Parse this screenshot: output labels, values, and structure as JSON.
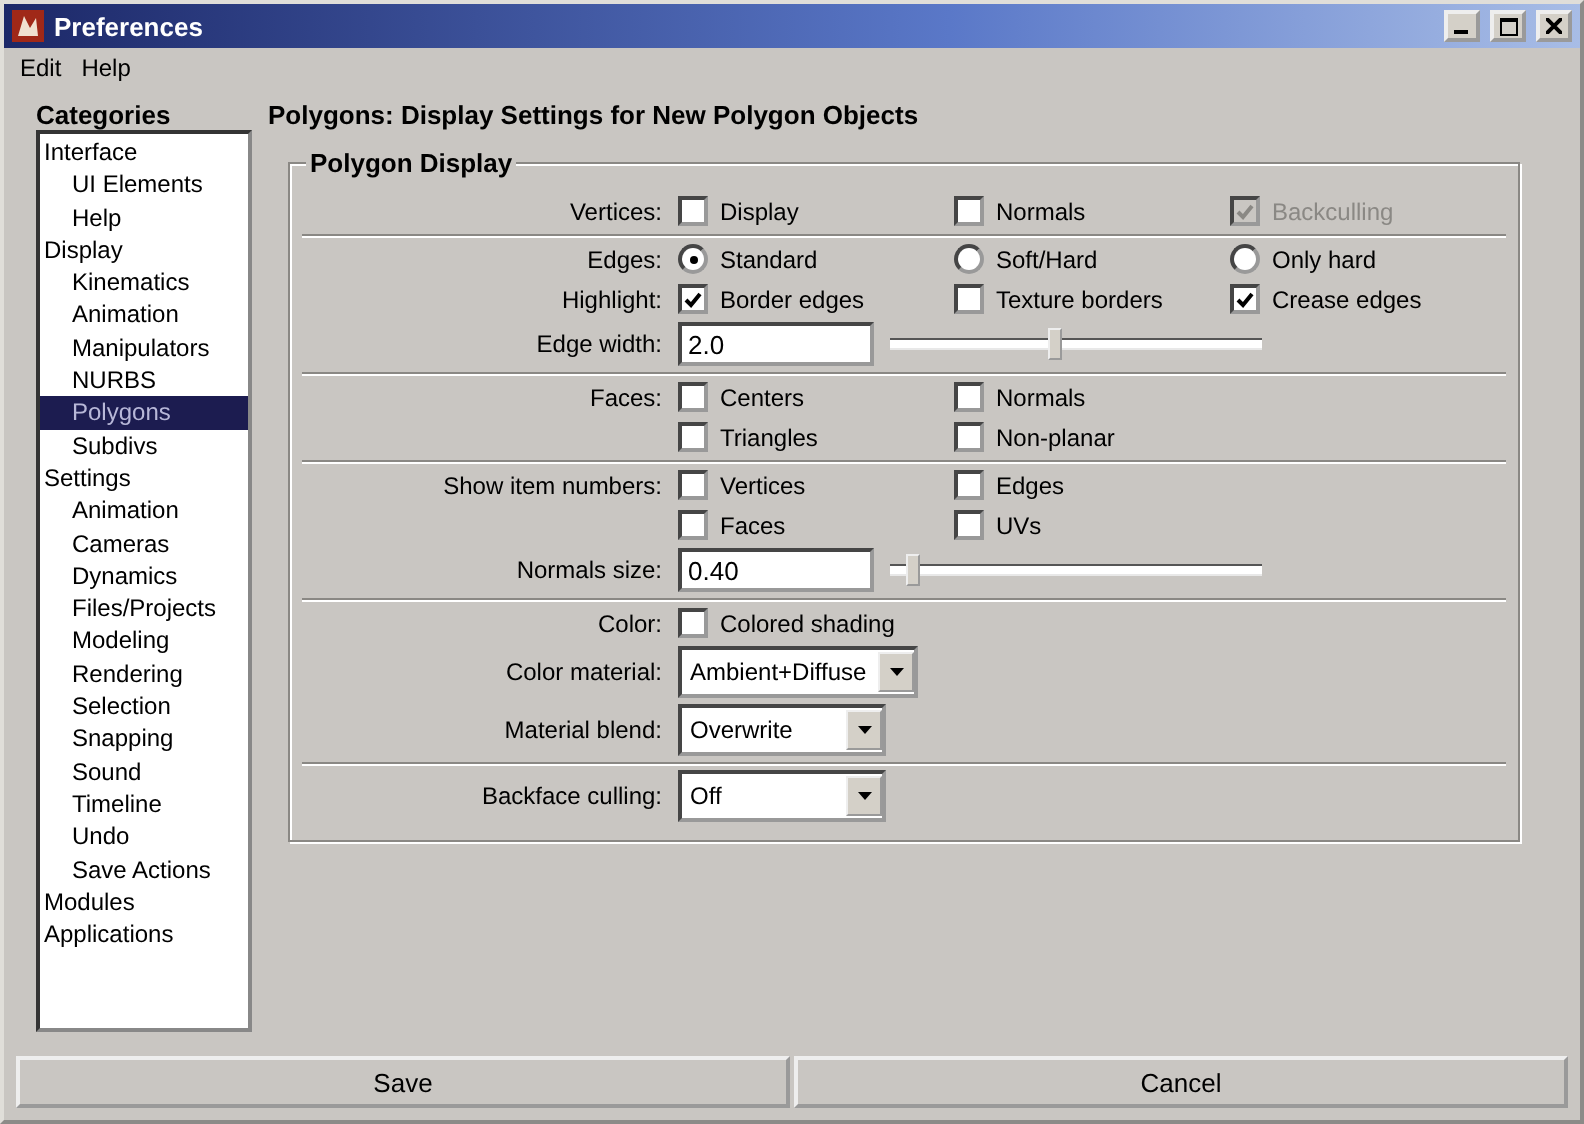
{
  "window": {
    "title": "Preferences"
  },
  "menu": [
    "Edit",
    "Help"
  ],
  "categories": {
    "title": "Categories",
    "items": [
      {
        "label": "Interface",
        "selected": false,
        "children": [
          {
            "label": "UI Elements",
            "selected": false
          },
          {
            "label": "Help",
            "selected": false
          }
        ]
      },
      {
        "label": "Display",
        "selected": false,
        "children": [
          {
            "label": "Kinematics",
            "selected": false
          },
          {
            "label": "Animation",
            "selected": false
          },
          {
            "label": "Manipulators",
            "selected": false
          },
          {
            "label": "NURBS",
            "selected": false
          },
          {
            "label": "Polygons",
            "selected": true
          },
          {
            "label": "Subdivs",
            "selected": false
          }
        ]
      },
      {
        "label": "Settings",
        "selected": false,
        "children": [
          {
            "label": "Animation",
            "selected": false
          },
          {
            "label": "Cameras",
            "selected": false
          },
          {
            "label": "Dynamics",
            "selected": false
          },
          {
            "label": "Files/Projects",
            "selected": false
          },
          {
            "label": "Modeling",
            "selected": false
          },
          {
            "label": "Rendering",
            "selected": false
          },
          {
            "label": "Selection",
            "selected": false
          },
          {
            "label": "Snapping",
            "selected": false
          },
          {
            "label": "Sound",
            "selected": false
          },
          {
            "label": "Timeline",
            "selected": false
          },
          {
            "label": "Undo",
            "selected": false
          },
          {
            "label": "Save Actions",
            "selected": false
          }
        ]
      },
      {
        "label": "Modules",
        "selected": false
      },
      {
        "label": "Applications",
        "selected": false
      }
    ]
  },
  "heading": "Polygons: Display Settings for New Polygon Objects",
  "group": {
    "title": "Polygon Display",
    "sections": [
      {
        "rows": [
          {
            "label": "Vertices:",
            "items": [
              {
                "kind": "checkbox",
                "label": "Display",
                "checked": false,
                "disabled": false
              },
              {
                "kind": "checkbox",
                "label": "Normals",
                "checked": false,
                "disabled": false
              },
              {
                "kind": "checkbox",
                "label": "Backculling",
                "checked": true,
                "disabled": true
              }
            ]
          }
        ]
      },
      {
        "rows": [
          {
            "label": "Edges:",
            "items": [
              {
                "kind": "radio",
                "label": "Standard",
                "selected": true
              },
              {
                "kind": "radio",
                "label": "Soft/Hard",
                "selected": false
              },
              {
                "kind": "radio",
                "label": "Only hard",
                "selected": false
              }
            ]
          },
          {
            "label": "Highlight:",
            "items": [
              {
                "kind": "checkbox",
                "label": "Border edges",
                "checked": true,
                "disabled": false
              },
              {
                "kind": "checkbox",
                "label": "Texture borders",
                "checked": false,
                "disabled": false
              },
              {
                "kind": "checkbox",
                "label": "Crease edges",
                "checked": true,
                "disabled": false
              }
            ]
          },
          {
            "label": "Edge width:",
            "items": [
              {
                "kind": "field",
                "value": "2.0"
              },
              {
                "kind": "slider",
                "level": 0.44
              }
            ]
          }
        ]
      },
      {
        "rows": [
          {
            "label": "Faces:",
            "items": [
              {
                "kind": "checkbox",
                "label": "Centers",
                "checked": false,
                "disabled": false
              },
              {
                "kind": "checkbox",
                "label": "Normals",
                "checked": false,
                "disabled": false
              }
            ]
          },
          {
            "items": [
              {
                "kind": "checkbox",
                "label": "Triangles",
                "checked": false,
                "disabled": false
              },
              {
                "kind": "checkbox",
                "label": "Non-planar",
                "checked": false,
                "disabled": false
              }
            ]
          }
        ]
      },
      {
        "rows": [
          {
            "label": "Show item numbers:",
            "items": [
              {
                "kind": "checkbox",
                "label": "Vertices",
                "checked": false,
                "disabled": false
              },
              {
                "kind": "checkbox",
                "label": "Edges",
                "checked": false,
                "disabled": false
              }
            ]
          },
          {
            "items": [
              {
                "kind": "checkbox",
                "label": "Faces",
                "checked": false,
                "disabled": false
              },
              {
                "kind": "checkbox",
                "label": "UVs",
                "checked": false,
                "disabled": false
              }
            ]
          },
          {
            "label": "Normals size:",
            "items": [
              {
                "kind": "field",
                "value": "0.40"
              },
              {
                "kind": "slider",
                "level": 0.06
              }
            ]
          }
        ]
      },
      {
        "rows": [
          {
            "label": "Color:",
            "items": [
              {
                "kind": "checkbox",
                "label": "Colored shading",
                "checked": false,
                "disabled": false
              }
            ]
          },
          {
            "label": "Color material:",
            "items": [
              {
                "kind": "dropdown",
                "value": "Ambient+Diffuse"
              }
            ]
          },
          {
            "label": "Material blend:",
            "items": [
              {
                "kind": "dropdown",
                "value": "Overwrite"
              }
            ]
          }
        ]
      },
      {
        "rows": [
          {
            "label": "Backface culling:",
            "items": [
              {
                "kind": "dropdown",
                "value": "Off"
              }
            ]
          }
        ]
      }
    ]
  },
  "buttons": [
    "Save",
    "Cancel"
  ]
}
